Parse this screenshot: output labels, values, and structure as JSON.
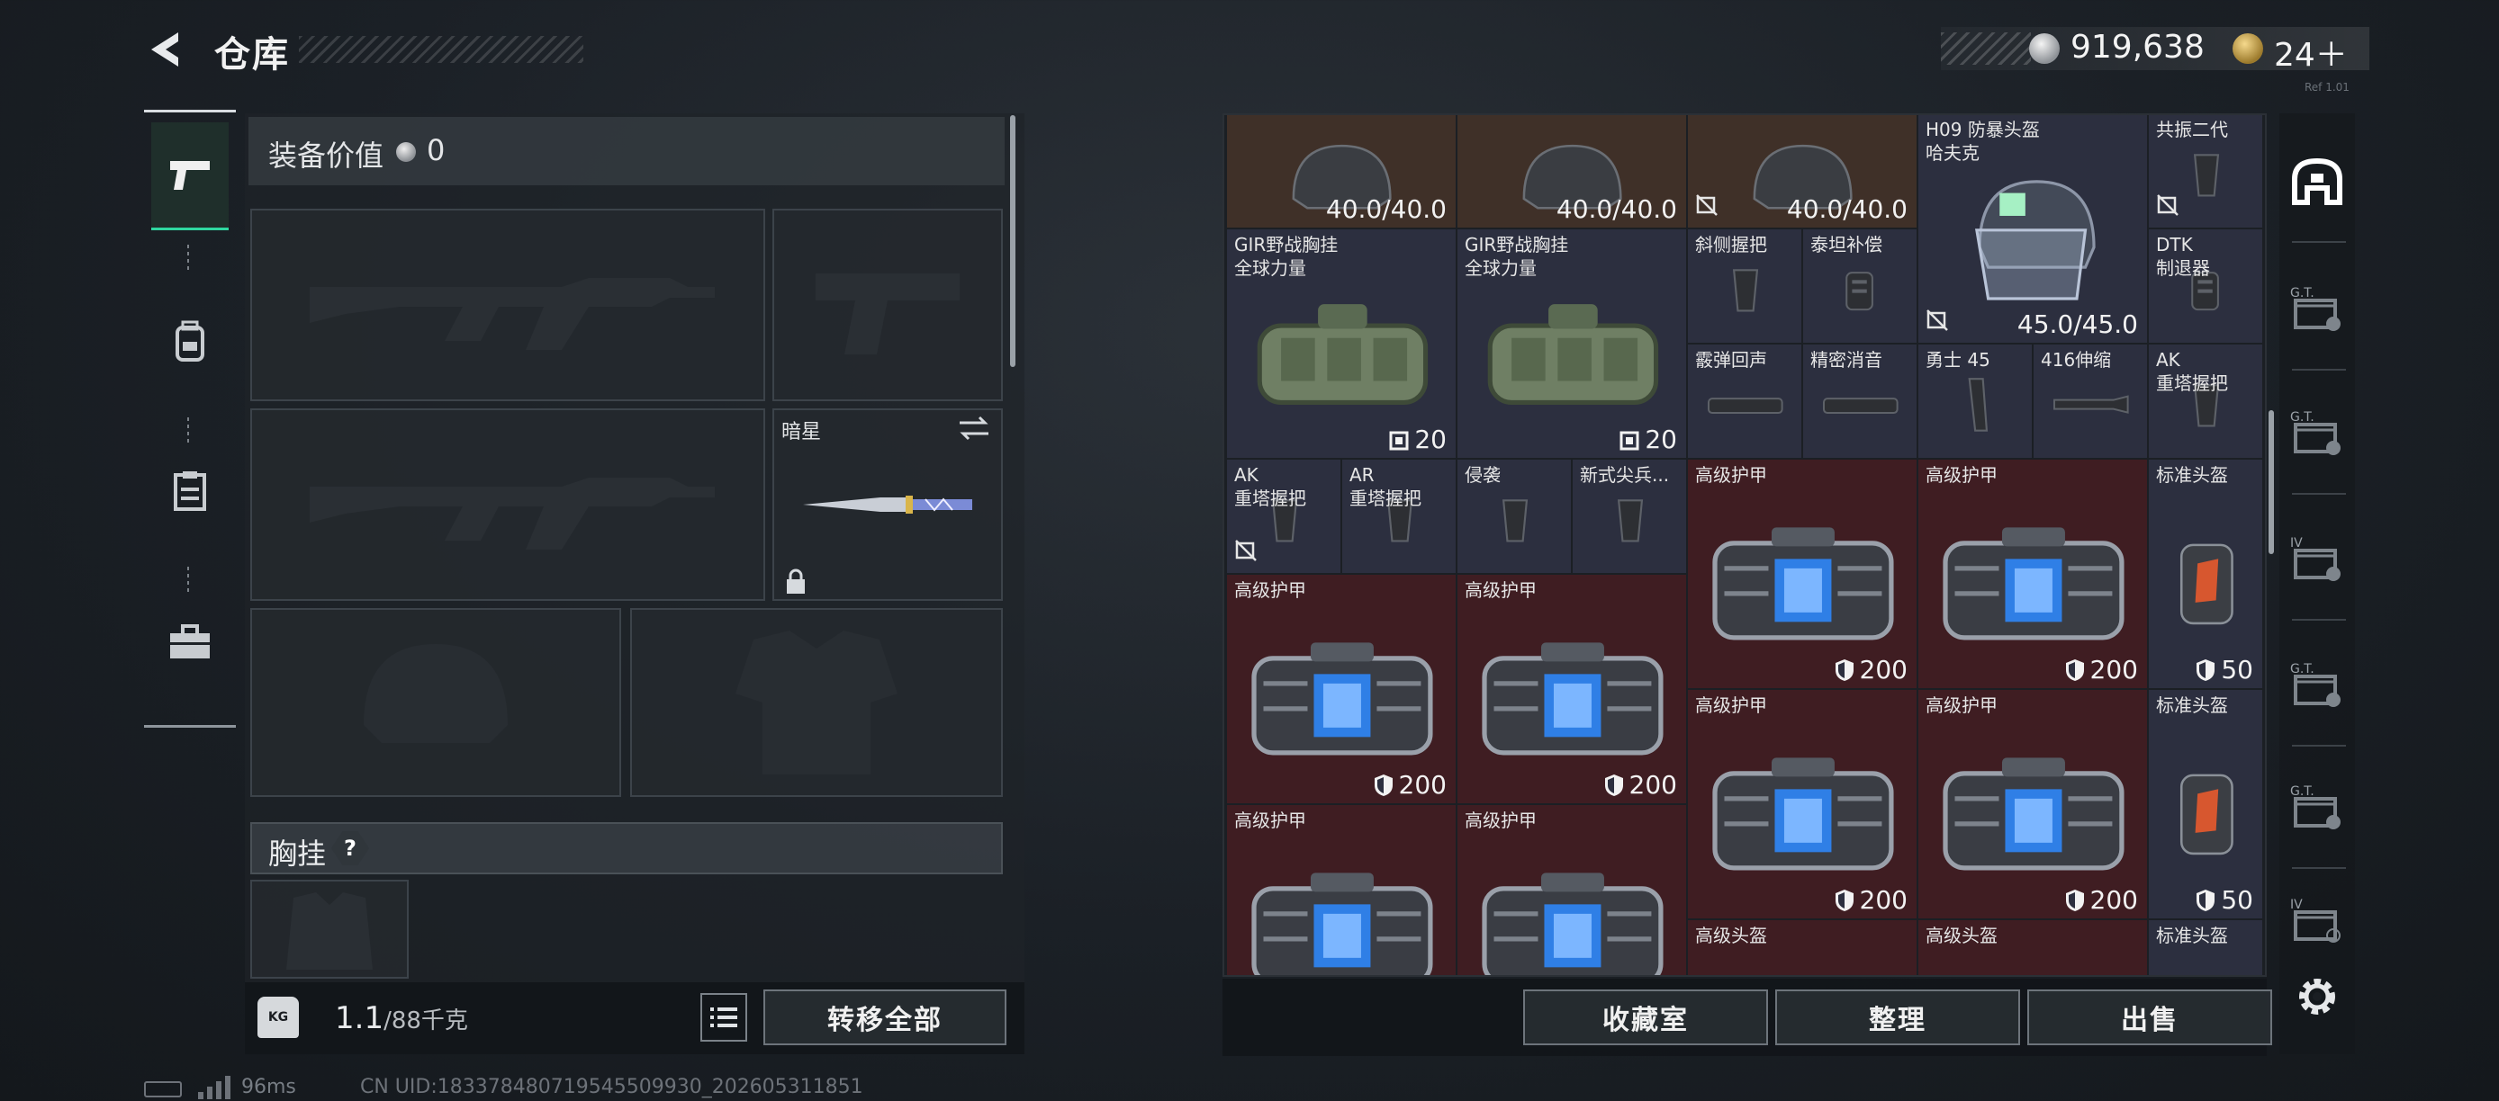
{
  "header": {
    "title": "仓库",
    "money": "919,638",
    "tickets": "24＋",
    "version_tag": "Ref 1.01"
  },
  "left_rail": {
    "tabs": [
      "pistol-icon",
      "backpack-icon",
      "clipboard-icon",
      "toolbox-icon"
    ]
  },
  "loadout": {
    "equip_value_label": "装备价值",
    "equip_value": "0",
    "melee_slot_name": "暗星",
    "chest_label": "胸挂",
    "chest_help": "?",
    "weight_value": "1.1",
    "weight_max": "/88千克",
    "weight_icon_text": "KG",
    "transfer_all": "转移全部"
  },
  "grid": {
    "cells": [
      {
        "label": "",
        "value": "40.0/40.0",
        "bg": "brown",
        "art": "helmet"
      },
      {
        "label": "",
        "value": "40.0/40.0",
        "bg": "brown",
        "art": "helmet"
      },
      {
        "label": "",
        "value": "40.0/40.0",
        "bg": "brown",
        "art": "helmet",
        "nodrop": true
      },
      {
        "label": "H09 防暴头盔\n哈夫克",
        "value": "45.0/45.0",
        "bg": "navy",
        "art": "riot-helmet",
        "nodrop": true
      },
      {
        "label": "共振二代",
        "value": "",
        "bg": "navy",
        "art": "grip",
        "nodrop": true
      },
      {
        "label": "GIR野战胸挂\n全球力量",
        "value": "20",
        "bg": "navy",
        "art": "rig",
        "value_icon": "capacity"
      },
      {
        "label": "GIR野战胸挂\n全球力量",
        "value": "20",
        "bg": "navy",
        "art": "rig",
        "value_icon": "capacity"
      },
      {
        "label": "斜侧握把",
        "value": "",
        "bg": "navy",
        "art": "grip"
      },
      {
        "label": "泰坦补偿",
        "value": "",
        "bg": "navy",
        "art": "muzzle"
      },
      {
        "label": "DTK\n制退器",
        "value": "",
        "bg": "navy",
        "art": "muzzle"
      },
      {
        "label": "霰弹回声",
        "value": "",
        "bg": "navy",
        "art": "suppressor"
      },
      {
        "label": "精密消音",
        "value": "",
        "bg": "navy",
        "art": "suppressor"
      },
      {
        "label": "勇士 45",
        "value": "",
        "bg": "navy",
        "art": "magazine"
      },
      {
        "label": "416伸缩",
        "value": "",
        "bg": "navy",
        "art": "stock"
      },
      {
        "label": "AK\n重塔握把",
        "value": "",
        "bg": "navy",
        "art": "grip"
      },
      {
        "label": "AK\n重塔握把",
        "value": "",
        "bg": "navy",
        "art": "grip",
        "nodrop": true
      },
      {
        "label": "AR\n重塔握把",
        "value": "",
        "bg": "navy",
        "art": "grip"
      },
      {
        "label": "侵袭",
        "value": "",
        "bg": "navy",
        "art": "grip"
      },
      {
        "label": "新式尖兵...",
        "value": "",
        "bg": "navy",
        "art": "grip"
      },
      {
        "label": "高级护甲",
        "value": "200",
        "bg": "red",
        "art": "armor",
        "value_icon": "shield"
      },
      {
        "label": "高级护甲",
        "value": "200",
        "bg": "red",
        "art": "armor",
        "value_icon": "shield"
      },
      {
        "label": "标准头盔",
        "value": "50",
        "bg": "navy",
        "art": "std-helmet",
        "value_icon": "shield"
      },
      {
        "label": "高级护甲",
        "value": "200",
        "bg": "red",
        "art": "armor",
        "value_icon": "shield"
      },
      {
        "label": "高级护甲",
        "value": "200",
        "bg": "red",
        "art": "armor",
        "value_icon": "shield"
      },
      {
        "label": "高级护甲",
        "value": "200",
        "bg": "red",
        "art": "armor",
        "value_icon": "shield"
      },
      {
        "label": "高级护甲",
        "value": "200",
        "bg": "red",
        "art": "armor",
        "value_icon": "shield"
      },
      {
        "label": "标准头盔",
        "value": "50",
        "bg": "navy",
        "art": "std-helmet",
        "value_icon": "shield"
      },
      {
        "label": "高级护甲",
        "value": "",
        "bg": "red",
        "art": "armor"
      },
      {
        "label": "高级护甲",
        "value": "",
        "bg": "red",
        "art": "armor"
      },
      {
        "label": "高级头盔",
        "value": "",
        "bg": "red",
        "art": "helmet"
      },
      {
        "label": "高级头盔",
        "value": "",
        "bg": "red",
        "art": "helmet"
      },
      {
        "label": "标准头盔",
        "value": "",
        "bg": "navy",
        "art": "std-helmet"
      }
    ],
    "buttons": {
      "collection": "收藏室",
      "organize": "整理",
      "sell": "出售"
    }
  },
  "right_rail": {
    "tabs": [
      "home-storage-icon",
      "crate-1-icon",
      "crate-2-icon",
      "crate-3-icon",
      "crate-4-icon",
      "crate-5-icon",
      "crate-add-icon"
    ],
    "tab_tags": [
      "",
      "G.T.",
      "G.T.",
      "IV",
      "G.T.",
      "G.T.",
      "IV"
    ]
  },
  "status": {
    "ping": "96ms",
    "uid": "CN UID:1833784807195455099​30_202605311851"
  },
  "colors": {
    "accent": "#2fd7a0",
    "cell_navy": "#2c2f3f",
    "cell_red": "#3f1d22",
    "cell_brown": "#3f3028"
  }
}
